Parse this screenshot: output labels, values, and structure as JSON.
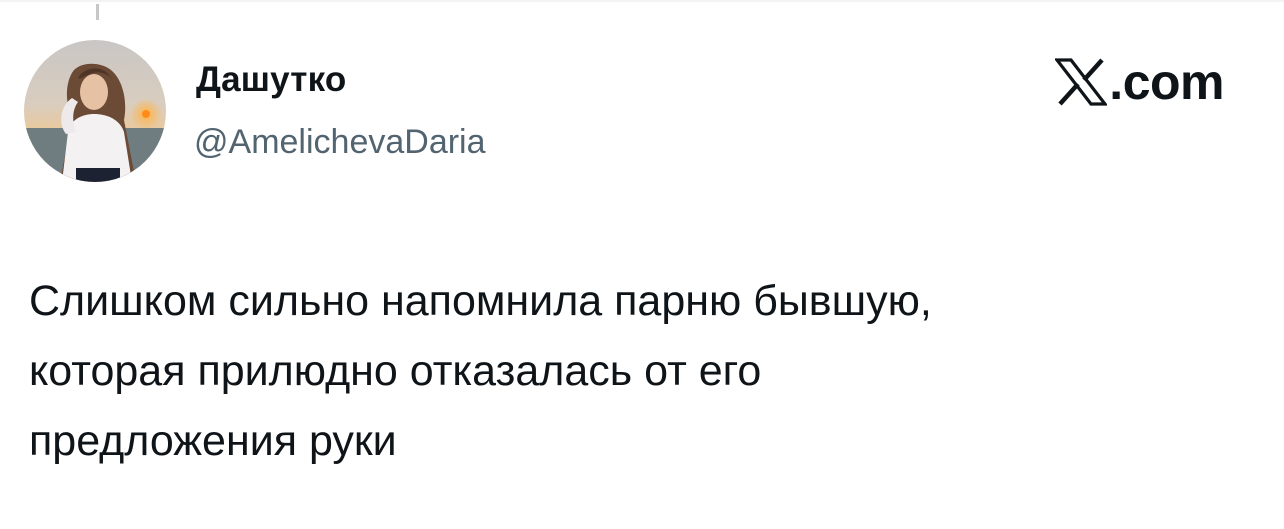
{
  "author": {
    "display_name": "Дашутко",
    "handle": "@AmelichevaDaria",
    "avatar": "profile-photo"
  },
  "brand": {
    "icon": "x-logo",
    "label": ".com"
  },
  "tweet": {
    "lines": [
      "Слишком сильно напомнила парню бывшую,",
      "которая прилюдно отказалась от его",
      "предложения руки"
    ]
  },
  "colors": {
    "text_primary": "#0f1419",
    "text_secondary": "#536471",
    "background": "#ffffff"
  }
}
